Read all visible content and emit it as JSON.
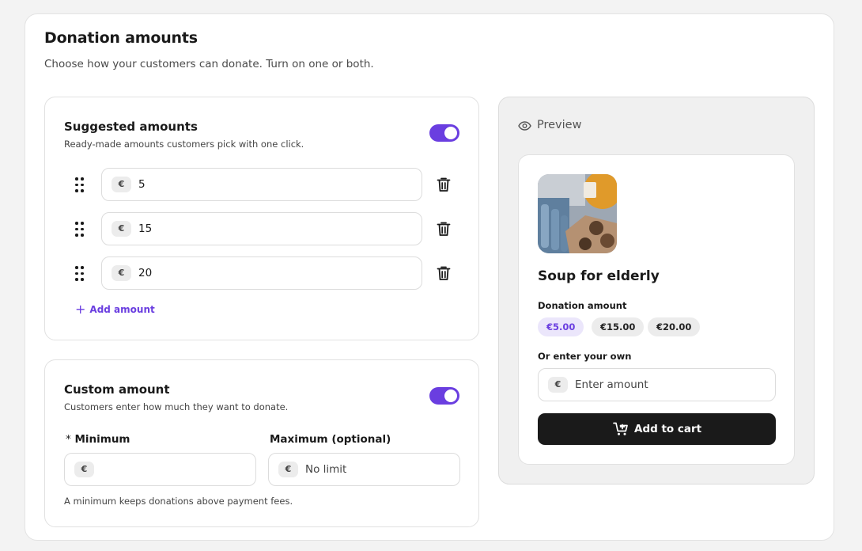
{
  "header": {
    "title": "Donation amounts",
    "subtitle": "Choose how your customers can donate. Turn on one or both."
  },
  "suggested": {
    "title": "Suggested amounts",
    "description": "Ready-made amounts customers pick with one click.",
    "enabled": true,
    "currency_symbol": "€",
    "amounts": [
      "5",
      "15",
      "20"
    ],
    "add_label": "Add amount"
  },
  "custom": {
    "title": "Custom amount",
    "description": "Customers enter how much they want to donate.",
    "enabled": true,
    "currency_symbol": "€",
    "minimum_required_marker": "*",
    "minimum_label": "Minimum",
    "minimum_value": "",
    "maximum_label": "Maximum (optional)",
    "maximum_placeholder": "No limit",
    "hint": "A minimum keeps donations above payment fees."
  },
  "preview": {
    "label": "Preview",
    "product_name": "Soup for elderly",
    "donation_label": "Donation amount",
    "chips": [
      "€5.00",
      "€15.00",
      "€20.00"
    ],
    "selected_chip": 0,
    "own_label": "Or enter your own",
    "currency_symbol": "€",
    "own_placeholder": "Enter amount",
    "cart_button": "Add to cart"
  },
  "icons": {
    "drag": "drag-handle-icon",
    "trash": "trash-icon",
    "plus": "plus-icon",
    "eye": "eye-icon",
    "cart": "cart-add-icon"
  },
  "colors": {
    "accent": "#6a3ee0",
    "accent_soft": "#ebe6fb",
    "button_dark": "#1a1a1a"
  }
}
